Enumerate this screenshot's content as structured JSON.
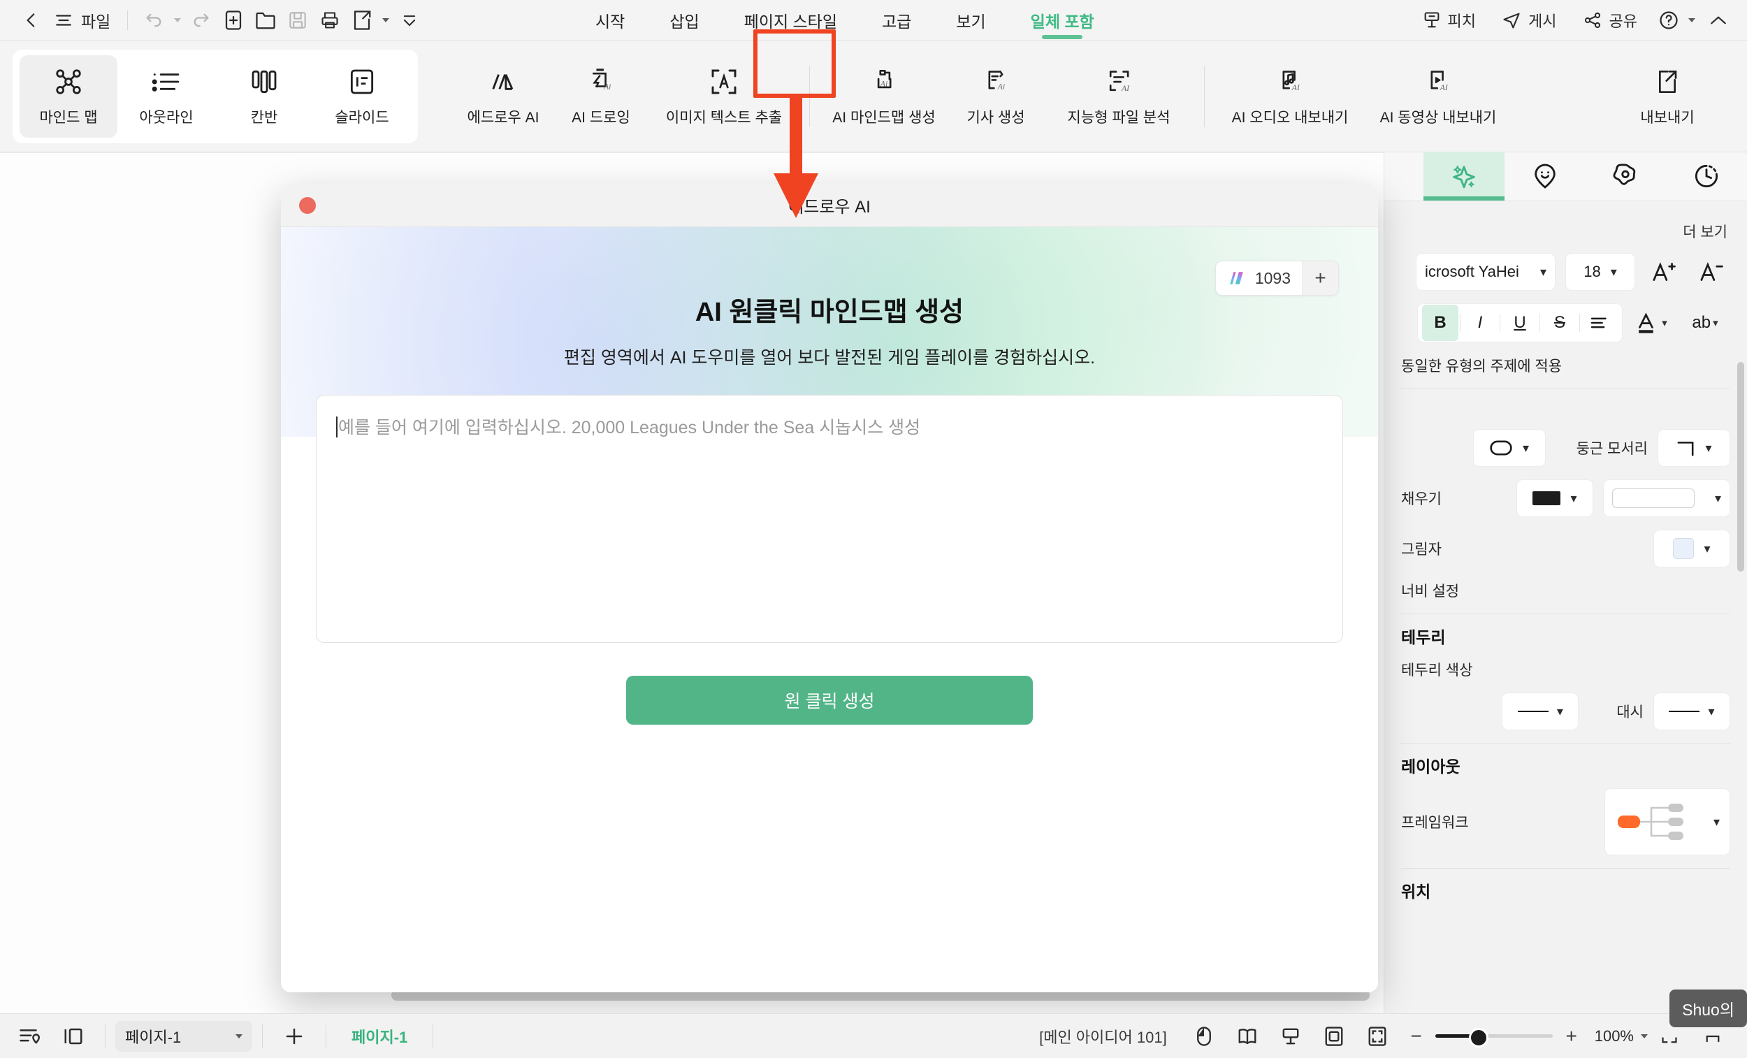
{
  "topbar": {
    "back_icon": "chevron-left-icon",
    "menu_icon": "hamburger-icon",
    "file_label": "파일",
    "quick_icons": [
      "undo-icon",
      "redo-icon",
      "new-icon",
      "open-folder-icon",
      "save-icon",
      "print-icon",
      "export-icon",
      "more-icon"
    ],
    "tabs": [
      {
        "label": "시작",
        "active": false
      },
      {
        "label": "삽입",
        "active": false
      },
      {
        "label": "페이지 스타일",
        "active": false
      },
      {
        "label": "고급",
        "active": false
      },
      {
        "label": "보기",
        "active": false
      },
      {
        "label": "일체 포함",
        "active": true
      }
    ],
    "right_items": [
      {
        "label": "피치",
        "icon": "presentation-icon"
      },
      {
        "label": "게시",
        "icon": "paper-plane-icon"
      },
      {
        "label": "공유",
        "icon": "share-nodes-icon"
      },
      {
        "label": "",
        "icon": "help-circle-icon"
      },
      {
        "label": "",
        "icon": "chevron-up-icon"
      }
    ]
  },
  "ribbon": {
    "views": [
      {
        "label": "마인드 맵",
        "icon": "mindmap-icon",
        "selected": true
      },
      {
        "label": "아웃라인",
        "icon": "outline-list-icon",
        "selected": false
      },
      {
        "label": "칸반",
        "icon": "kanban-icon",
        "selected": false
      },
      {
        "label": "슬라이드",
        "icon": "slide-icon",
        "selected": false
      }
    ],
    "ai_tools": [
      {
        "label": "에드로우 AI",
        "icon": "edrawai-icon",
        "highlighted": false
      },
      {
        "label": "AI 드로잉",
        "icon": "ai-drawing-icon",
        "highlighted": false
      },
      {
        "label": "이미지 텍스트 추출",
        "icon": "image-ocr-icon",
        "highlighted": false
      },
      {
        "label": "AI 마인드맵 생성",
        "icon": "ai-mindmap-icon",
        "highlighted": true
      },
      {
        "label": "기사 생성",
        "icon": "ai-article-icon",
        "highlighted": false
      },
      {
        "label": "지능형 파일 분석",
        "icon": "ai-file-analysis-icon",
        "highlighted": false
      }
    ],
    "export_tools": [
      {
        "label": "AI 오디오 내보내기",
        "icon": "ai-audio-icon"
      },
      {
        "label": "AI 동영상 내보내기",
        "icon": "ai-video-icon"
      }
    ],
    "export_button": {
      "label": "내보내기",
      "icon": "export-box-icon"
    }
  },
  "annotation": {
    "highlight_color": "#ef4322",
    "target": "AI 마인드맵 생성"
  },
  "dialog": {
    "title": "에드로우 AI",
    "close_label": "닫기",
    "credits": {
      "icon": "ai-credits-icon",
      "value": "1093",
      "plus_label": "+"
    },
    "heading": "AI 원클릭 마인드맵 생성",
    "subtitle": "편집 영역에서 AI 도우미를 열어 보다 발전된 게임 플레이를 경험하십시오.",
    "prompt_placeholder": "예를 들어 여기에 입력하십시오. 20,000 Leagues Under the Sea 시놉시스 생성",
    "prompt_value": "",
    "generate_button": "원 클릭 생성",
    "generate_button_color": "#52b588"
  },
  "right_panel": {
    "tabs": [
      {
        "icon": "ai-sparkle-icon",
        "active": true
      },
      {
        "icon": "smiley-pin-icon",
        "active": false
      },
      {
        "icon": "flower-gear-icon",
        "active": false
      },
      {
        "icon": "history-clock-icon",
        "active": false
      }
    ],
    "more_link": "더 보기",
    "apply_same_type": "동일한 유형의 주제에 적용",
    "font_family": "icrosoft YaHei",
    "font_size": "18",
    "increase_font_icon": "font-increase-icon",
    "decrease_font_icon": "font-decrease-icon",
    "format_icons": [
      "bold-icon",
      "italic-icon",
      "underline-icon",
      "strikethrough-icon",
      "align-icon",
      "font-color-icon",
      "highlight-icon"
    ],
    "shape_section": {
      "rounded_corner_label": "둥근 모서리",
      "fill_label": "채우기",
      "shadow_label": "그림자",
      "width_label": "너비 설정",
      "fill_color": "#1d1d1d",
      "shadow_color": "#eaf0fa"
    },
    "border_section": {
      "heading": "테두리",
      "border_color_label": "테두리 색상",
      "dash_label": "대시"
    },
    "layout_section": {
      "heading": "레이아웃",
      "framework_label": "프레임워크",
      "framework_accent": "#ff6a2b"
    },
    "position_section": {
      "heading": "위치"
    }
  },
  "statusbar": {
    "outline_icon": "outline-locate-icon",
    "panel_icon": "side-panel-icon",
    "page_select": "페이지-1",
    "add_page_label": "+",
    "page_tab": "페이지-1",
    "idea_count": "[메인 아이디어 101]",
    "view_icons": [
      "mouse-icon",
      "book-icon",
      "presentation-view-icon",
      "fit-page-icon",
      "fullscreen-icon"
    ],
    "zoom_minus": "−",
    "zoom_plus": "+",
    "zoom_value": "100%",
    "tooltip": "Shuo의"
  }
}
